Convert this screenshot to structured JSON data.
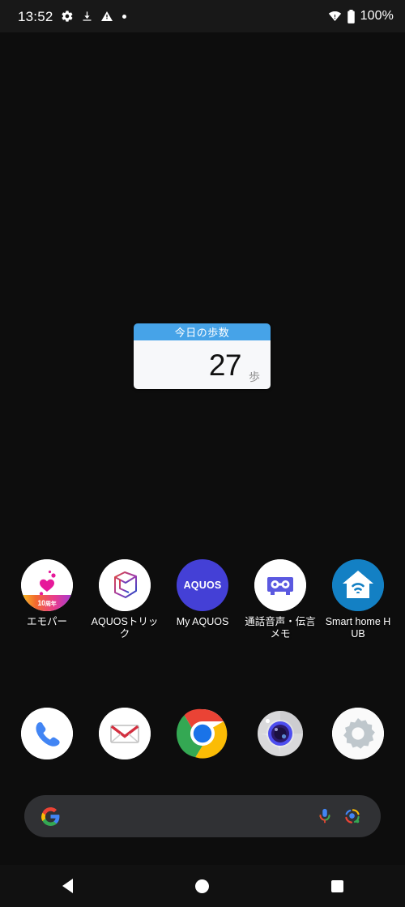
{
  "statusbar": {
    "time": "13:52",
    "battery_percent": "100%",
    "icons_left": [
      "gear-icon",
      "download-icon",
      "warning-triangle-icon",
      "dot-icon"
    ],
    "icons_right": [
      "wifi-icon",
      "battery-full-icon"
    ]
  },
  "widget": {
    "title": "今日の歩数",
    "value": "27",
    "unit": "歩",
    "header_color": "#46a3e8",
    "body_color": "#f7f8fa"
  },
  "apps": [
    {
      "label": "エモパー",
      "icon": "emopa-icon",
      "badge": "10周年",
      "badge_main": "10",
      "badge_sub": "周年"
    },
    {
      "label": "AQUOSトリック",
      "icon": "aquos-trick-cube-icon"
    },
    {
      "label": "My AQUOS",
      "icon": "my-aquos-icon",
      "icon_text": "AQUOS"
    },
    {
      "label": "通話音声・伝言メモ",
      "icon": "voicemail-cassette-icon"
    },
    {
      "label": "Smart home HUB",
      "icon": "smart-home-hub-icon"
    }
  ],
  "dock": [
    {
      "label": "Phone",
      "icon": "phone-icon"
    },
    {
      "label": "Email",
      "icon": "email-icon"
    },
    {
      "label": "Chrome",
      "icon": "chrome-icon"
    },
    {
      "label": "Camera",
      "icon": "camera-icon"
    },
    {
      "label": "Settings",
      "icon": "settings-gear-icon"
    }
  ],
  "search": {
    "value": "",
    "placeholder": "",
    "logo": "google-g-icon",
    "mic": "microphone-icon",
    "lens": "google-lens-icon"
  },
  "navbar": {
    "back": "back-triangle-icon",
    "home": "home-circle-icon",
    "recents": "recents-square-icon"
  },
  "colors": {
    "background": "#0d0d0d",
    "statusbar": "#181818",
    "searchbar": "#303134",
    "widget_blue": "#46a3e8",
    "smarthome_blue": "#1380c4",
    "aquos_purple": "#4440d6"
  }
}
